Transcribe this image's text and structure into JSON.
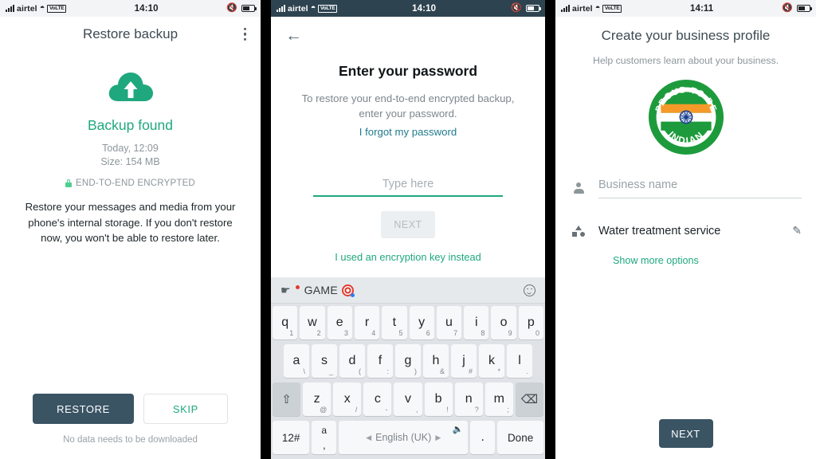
{
  "panel1": {
    "status": {
      "carrier": "airtel",
      "network": "VoLTE",
      "time": "14:10",
      "wifi_icon": "wifi-icon",
      "mute_icon": "mute-icon",
      "battery_icon": "battery-icon"
    },
    "appbar": {
      "title": "Restore backup",
      "overflow_icon": "overflow-menu-icon"
    },
    "cloud_icon": "cloud-upload-icon",
    "headline": "Backup found",
    "date": "Today, 12:09",
    "size": "Size: 154 MB",
    "encryption_label": "END-TO-END ENCRYPTED",
    "lock_icon": "lock-icon",
    "description": "Restore your messages and media from your phone's internal storage. If you don't restore now, you won't be able to restore later.",
    "restore_label": "RESTORE",
    "skip_label": "SKIP",
    "footer_note": "No data needs to be downloaded",
    "accent_green": "#1fa87e",
    "button_dark": "#3a5464"
  },
  "panel2": {
    "status": {
      "carrier": "airtel",
      "network": "VoLTE",
      "time": "14:10",
      "wifi_icon": "wifi-icon",
      "mute_icon": "mute-icon",
      "battery_icon": "battery-icon"
    },
    "back_icon": "back-arrow-icon",
    "title": "Enter your password",
    "subtitle": "To restore your end-to-end encrypted backup, enter your password.",
    "forgot_link": "I forgot my password",
    "input_value": "",
    "input_placeholder": "Type here",
    "next_label": "NEXT",
    "encryption_key_link": "I used an encryption key instead",
    "keyboard": {
      "toolbar": {
        "tap_icon": "tap-hand-icon",
        "badge_icon": "red-dot-badge-icon",
        "label": "GAME",
        "target_icon": "game-target-icon",
        "emoji_icon": "emoji-smiley-icon"
      },
      "row1": [
        {
          "main": "q",
          "sub": "1"
        },
        {
          "main": "w",
          "sub": "2"
        },
        {
          "main": "e",
          "sub": "3"
        },
        {
          "main": "r",
          "sub": "4"
        },
        {
          "main": "t",
          "sub": "5"
        },
        {
          "main": "y",
          "sub": "6"
        },
        {
          "main": "u",
          "sub": "7"
        },
        {
          "main": "i",
          "sub": "8"
        },
        {
          "main": "o",
          "sub": "9"
        },
        {
          "main": "p",
          "sub": "0"
        }
      ],
      "row2": [
        {
          "main": "a",
          "sub": "\\"
        },
        {
          "main": "s",
          "sub": "_"
        },
        {
          "main": "d",
          "sub": "("
        },
        {
          "main": "f",
          "sub": ":"
        },
        {
          "main": "g",
          "sub": ")"
        },
        {
          "main": "h",
          "sub": "&"
        },
        {
          "main": "j",
          "sub": "#"
        },
        {
          "main": "k",
          "sub": "*"
        },
        {
          "main": "l",
          "sub": "."
        }
      ],
      "row3": [
        {
          "main": "z",
          "sub": "@"
        },
        {
          "main": "x",
          "sub": "/"
        },
        {
          "main": "c",
          "sub": "-"
        },
        {
          "main": "v",
          "sub": ","
        },
        {
          "main": "b",
          "sub": "!"
        },
        {
          "main": "n",
          "sub": "?"
        },
        {
          "main": "m",
          "sub": ";"
        }
      ],
      "shift_icon": "shift-icon",
      "backspace_icon": "backspace-icon",
      "numeric_label": "12#",
      "comma_main": "a",
      "comma_sub": ",",
      "space_label": "English (UK)",
      "space_prev_icon": "arrow-left-icon",
      "space_next_icon": "arrow-right-icon",
      "mic_icon": "microphone-icon",
      "period_label": ".",
      "done_label": "Done"
    }
  },
  "panel3": {
    "status": {
      "carrier": "airtel",
      "network": "VoLTE",
      "time": "14:11",
      "wifi_icon": "wifi-icon",
      "mute_icon": "mute-icon",
      "battery_icon": "battery-icon"
    },
    "title": "Create your business profile",
    "subtitle": "Help customers learn about your business.",
    "logo": {
      "name": "business-profile-logo",
      "top_text": "PROUD TO BE",
      "bottom_text": "INDIAN",
      "ring_color": "#1d9b3c",
      "saffron": "#f59a28",
      "white": "#ffffff",
      "green": "#1d9b3c",
      "chakra_color": "#1b3f8f"
    },
    "business_name_placeholder": "Business name",
    "business_name_value": "",
    "person_icon": "person-icon",
    "category_icon": "category-shapes-icon",
    "category_value": "Water treatment service",
    "edit_icon": "pencil-edit-icon",
    "show_more_label": "Show more options",
    "next_label": "NEXT"
  }
}
